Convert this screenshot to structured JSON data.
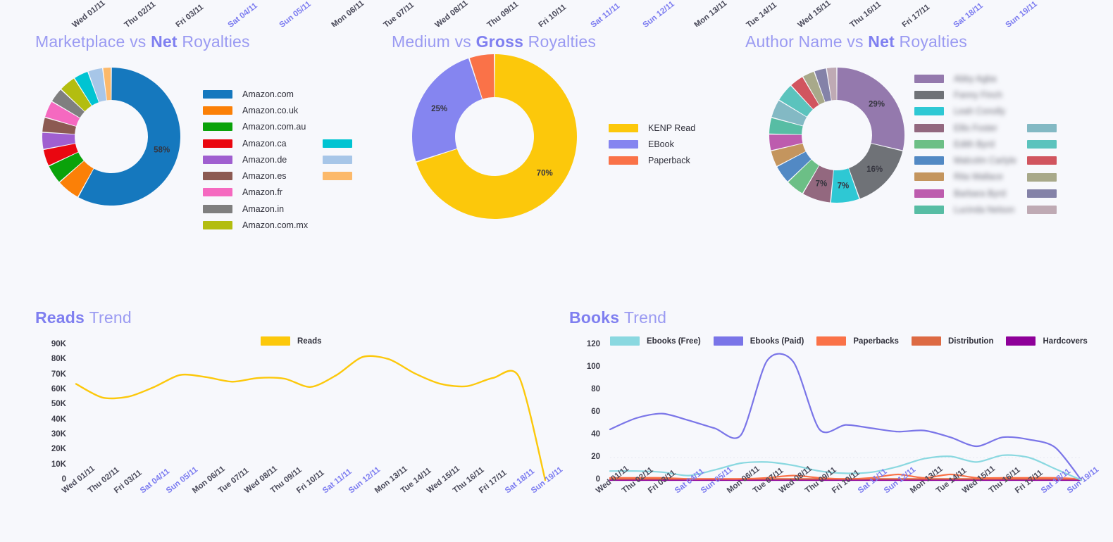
{
  "colors": {
    "background": "#f7f8fc",
    "title_light": "#9a9af2",
    "title_bold": "#7f7ff0",
    "weekend_label": "#7b7bf0",
    "axis_label": "#4a4a5a"
  },
  "top_axis": {
    "labels": [
      "Wed 01/11",
      "Thu 02/11",
      "Fri 03/11",
      "Sat 04/11",
      "Sun 05/11",
      "Mon 06/11",
      "Tue 07/11",
      "Wed 08/11",
      "Thu 09/11",
      "Fri 10/11",
      "Sat 11/11",
      "Sun 12/11",
      "Mon 13/11",
      "Tue 14/11",
      "Wed 15/11",
      "Thu 16/11",
      "Fri 17/11",
      "Sat 18/11",
      "Sun 19/11"
    ],
    "weekend_flags": [
      false,
      false,
      false,
      true,
      true,
      false,
      false,
      false,
      false,
      false,
      true,
      true,
      false,
      false,
      false,
      false,
      false,
      true,
      true
    ]
  },
  "panels": {
    "marketplace": {
      "title_prefix": "Marketplace vs ",
      "title_metric": "Net",
      "title_suffix": " Royalties"
    },
    "medium": {
      "title_prefix": "Medium vs ",
      "title_metric": "Gross",
      "title_suffix": " Royalties"
    },
    "author": {
      "title_prefix": "Author Name vs ",
      "title_metric": "Net",
      "title_suffix": " Royalties"
    }
  },
  "chart_data": [
    {
      "type": "pie",
      "id": "marketplace-net-royalties",
      "title": "Marketplace vs Net Royalties",
      "legend": "right",
      "labels": [
        "Amazon.com",
        "Amazon.co.uk",
        "Amazon.com.au",
        "Amazon.ca",
        "Amazon.de",
        "Amazon.es",
        "Amazon.fr",
        "Amazon.in",
        "Amazon.com.mx",
        "",
        "",
        ""
      ],
      "values": [
        58,
        5.5,
        4.5,
        4,
        4,
        3.5,
        4,
        3.5,
        4,
        3.5,
        3.5,
        2
      ],
      "colors": [
        "#1578be",
        "#fb8007",
        "#0aa20a",
        "#ea0710",
        "#a05fd0",
        "#8c5a52",
        "#f569c0",
        "#7f7f7f",
        "#b3bd10",
        "#00c4d2",
        "#a7c6e8",
        "#fcb96a"
      ],
      "data_labels": [
        {
          "slice": "Amazon.com",
          "text": "58%"
        }
      ]
    },
    {
      "type": "pie",
      "id": "medium-gross-royalties",
      "title": "Medium vs Gross Royalties",
      "legend": "right",
      "labels": [
        "KENP Read",
        "EBook",
        "Paperback"
      ],
      "values": [
        70,
        25,
        5
      ],
      "colors": [
        "#fcc80b",
        "#8585f0",
        "#fa7248"
      ],
      "data_labels": [
        {
          "slice": "KENP Read",
          "text": "70%"
        },
        {
          "slice": "EBook",
          "text": "25%"
        }
      ]
    },
    {
      "type": "pie",
      "id": "author-net-royalties",
      "title": "Author Name vs Net Royalties",
      "legend": "right",
      "legend_redacted": true,
      "labels": [
        "Abby Agba",
        "Fanny Finch",
        "Leah Conolly",
        "Ellis Foster",
        "Edith Byrd",
        "Malcolm Carlyle",
        "Rita Wallace",
        "Barbara Byrd",
        "Lucinda Nelson",
        "",
        "",
        "",
        "",
        "",
        ""
      ],
      "values": [
        29,
        16,
        7,
        7,
        4.5,
        4.5,
        4,
        4,
        4,
        4.5,
        4.5,
        3.5,
        3,
        3,
        2.5
      ],
      "colors": [
        "#9479ad",
        "#6f7277",
        "#2ec8d4",
        "#93687f",
        "#6cbf86",
        "#5289c4",
        "#c4955e",
        "#bd5cae",
        "#57bda4",
        "#83b9c4",
        "#5bc3bd",
        "#d1555f",
        "#a8a98a",
        "#8482a8",
        "#bfaab4"
      ],
      "data_labels": [
        {
          "slice": "Abby Agba",
          "text": "29%"
        },
        {
          "slice": "Fanny Finch",
          "text": "16%"
        },
        {
          "slice": "Leah Conolly",
          "text": "7%"
        },
        {
          "slice": "Ellis Foster",
          "text": "7%"
        }
      ]
    },
    {
      "type": "line",
      "id": "reads-trend",
      "title_prefix": "Reads ",
      "title_suffix": "Trend",
      "title": "Reads Trend",
      "grid": false,
      "legend": "top",
      "x": [
        "Wed 01/11",
        "Thu 02/11",
        "Fri 03/11",
        "Sat 04/11",
        "Sun 05/11",
        "Mon 06/11",
        "Tue 07/11",
        "Wed 08/11",
        "Thu 09/11",
        "Fri 10/11",
        "Sat 11/11",
        "Sun 12/11",
        "Mon 13/11",
        "Tue 14/11",
        "Wed 15/11",
        "Thu 16/11",
        "Fri 17/11",
        "Sat 18/11",
        "Sun 19/11"
      ],
      "weekend_flags": [
        false,
        false,
        false,
        true,
        true,
        false,
        false,
        false,
        false,
        false,
        true,
        true,
        false,
        false,
        false,
        false,
        false,
        true,
        true
      ],
      "ylim": [
        0,
        90000
      ],
      "yticks": [
        0,
        10000,
        20000,
        30000,
        40000,
        50000,
        60000,
        70000,
        80000,
        90000
      ],
      "yticklabels": [
        "0",
        "10K",
        "20K",
        "30K",
        "40K",
        "50K",
        "60K",
        "70K",
        "80K",
        "90K"
      ],
      "series": [
        {
          "name": "Reads",
          "color": "#fcc80b",
          "values": [
            64000,
            55000,
            55500,
            62000,
            70000,
            68500,
            65500,
            68000,
            67500,
            62000,
            70000,
            82000,
            80500,
            71000,
            64000,
            62500,
            68000,
            68500,
            0
          ]
        }
      ]
    },
    {
      "type": "line",
      "id": "books-trend",
      "title_prefix": "Books ",
      "title_suffix": "Trend",
      "title": "Books Trend",
      "grid": false,
      "legend": "top",
      "x": [
        "Wed 01/11",
        "Thu 02/11",
        "Fri 03/11",
        "Sat 04/11",
        "Sun 05/11",
        "Mon 06/11",
        "Tue 07/11",
        "Wed 08/11",
        "Thu 09/11",
        "Fri 10/11",
        "Sat 11/11",
        "Sun 12/11",
        "Mon 13/11",
        "Tue 14/11",
        "Wed 15/11",
        "Thu 16/11",
        "Fri 17/11",
        "Sat 18/11",
        "Sun 19/11"
      ],
      "weekend_flags": [
        false,
        false,
        false,
        true,
        true,
        false,
        false,
        false,
        false,
        false,
        true,
        true,
        false,
        false,
        false,
        false,
        false,
        true,
        true
      ],
      "ylim": [
        0,
        120
      ],
      "yticks": [
        0,
        20,
        40,
        60,
        80,
        100,
        120
      ],
      "yticklabels": [
        "0",
        "20",
        "40",
        "60",
        "80",
        "100",
        "120"
      ],
      "series": [
        {
          "name": "Ebooks (Free)",
          "color": "#8ad8e0",
          "values": [
            8,
            8,
            7,
            4,
            9,
            15,
            16,
            13,
            8,
            6,
            7,
            12,
            19,
            21,
            16,
            22,
            20,
            10,
            0
          ]
        },
        {
          "name": "Ebooks (Paid)",
          "color": "#7a75e8",
          "values": [
            45,
            55,
            59,
            53,
            46,
            40,
            106,
            105,
            45,
            49,
            46,
            43,
            44,
            38,
            30,
            38,
            36,
            29,
            0
          ]
        },
        {
          "name": "Paperbacks",
          "color": "#fa7248",
          "values": [
            2,
            2,
            2,
            1,
            1,
            1,
            2,
            4,
            2,
            1,
            2,
            5,
            2,
            5,
            2,
            2,
            2,
            2,
            1
          ]
        },
        {
          "name": "Distribution",
          "color": "#dd6a43",
          "values": [
            1,
            1,
            1,
            1,
            1,
            1,
            1,
            1,
            1,
            1,
            1,
            1,
            1,
            1,
            1,
            1,
            1,
            1,
            1
          ]
        },
        {
          "name": "Hardcovers",
          "color": "#8e0099",
          "values": [
            0,
            0,
            0,
            0,
            0,
            0,
            0,
            0,
            0,
            0,
            0,
            0,
            0,
            0,
            0,
            0,
            0,
            0,
            0
          ]
        }
      ]
    }
  ]
}
